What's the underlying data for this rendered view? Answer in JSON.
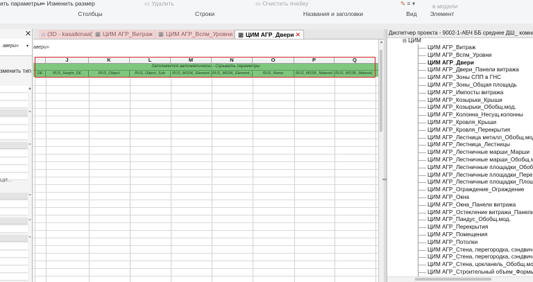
{
  "ribbon": {
    "buttons": [
      {
        "label": "ить параметры",
        "disabled": false
      },
      {
        "label": "Изменить размер",
        "disabled": false
      },
      {
        "label": "Удалить",
        "disabled": true
      },
      {
        "label": "Очистить ячейку",
        "disabled": true
      },
      {
        "label": "в модели",
        "disabled": true
      }
    ],
    "groups": [
      "Столбцы",
      "Строки",
      "Названия и заголовки",
      "Вид",
      "Элемент"
    ]
  },
  "left_panel": {
    "close_glyph": "✕",
    "top_field_text": "авери»",
    "type_label": "зменить тип",
    "elided_value": "ЦИ..."
  },
  "tabs": [
    {
      "label": "(3D - kasatkinaal)",
      "active": false
    },
    {
      "label": "ЦИМ АГР_Витраж",
      "active": false
    },
    {
      "label": "ЦИМ АГР_Вспм_Уровни",
      "active": false
    },
    {
      "label": "ЦИМ АГР_Двери",
      "active": true
    }
  ],
  "sheet": {
    "title_fragment": "авери»",
    "column_letters": [
      "",
      "J",
      "K",
      "L",
      "M",
      "N",
      "O",
      "P",
      "Q"
    ],
    "group_header": "Заполняются автоматически - Скрывать параметры",
    "fields": [
      "DE",
      "RUS_Height_DE",
      "RUS_Object",
      "RUS_Object_Sub",
      "RUS_MSSK_Element",
      "RUS_MSSK_Element_",
      "RUS_Name",
      "RUS_MSSK_Material",
      "RUS_MSSK_Material_"
    ]
  },
  "browser": {
    "title": "Диспетчер проекта - 9002-1-АБЧ ББ среднее ДШ_ комната п...",
    "root": "ЦИМ",
    "items": [
      "ЦИМ АГР_Витраж",
      "ЦИМ АГР_Вспм_Уровни",
      "ЦИМ АГР_Двери",
      "ЦИМ АГР_Двери_Панели витража",
      "ЦИМ АГР_Зоны СПП в ГНС",
      "ЦИМ АГР_Зоны_Общая площадь",
      "ЦИМ АГР_Импосты витража",
      "ЦИМ АГР_Козырьки_Крыши",
      "ЦИМ АГР_Козырьки_Обобщ.мод.",
      "ЦИМ АГР_Колонна_Несущ.колонны",
      "ЦИМ АГР_Кровля_Крыши",
      "ЦИМ АГР_Кровля_Перекрытия",
      "ЦИМ АГР_Лестница металл_Обобщ.мод.",
      "ЦИМ АГР_Лестница_Лестницы",
      "ЦИМ АГР_Лестничные марши_Марши",
      "ЦИМ АГР_Лестничные марши_Обобщ.мод.",
      "ЦИМ АГР_Лестничные площадки_Обобщ.мод.",
      "ЦИМ АГР_Лестничные площадки_Перекрыти",
      "ЦИМ АГР_Лестничные площадки_Площадки",
      "ЦИМ АГР_Ограждение_Ограждение",
      "ЦИМ АГР_Окна",
      "ЦИМ АГР_Окна_Панели витража",
      "ЦИМ АГР_Остекление витража_Панели витраж",
      "ЦИМ АГР_Пандус_Обобщ.мод.",
      "ЦИМ АГР_Перекрытия",
      "ЦИМ АГР_Помещения",
      "ЦИМ АГР_Потолки",
      "ЦИМ АГР_Стена, перегородка, сэндвич-пане",
      "ЦИМ АГР_Стена, перегородка, сэндвич-пане",
      "ЦИМ АГР_Стена, цокланель_Обобщ.мод.",
      "ЦИМ АГР_Строительный объем_Формы"
    ]
  }
}
